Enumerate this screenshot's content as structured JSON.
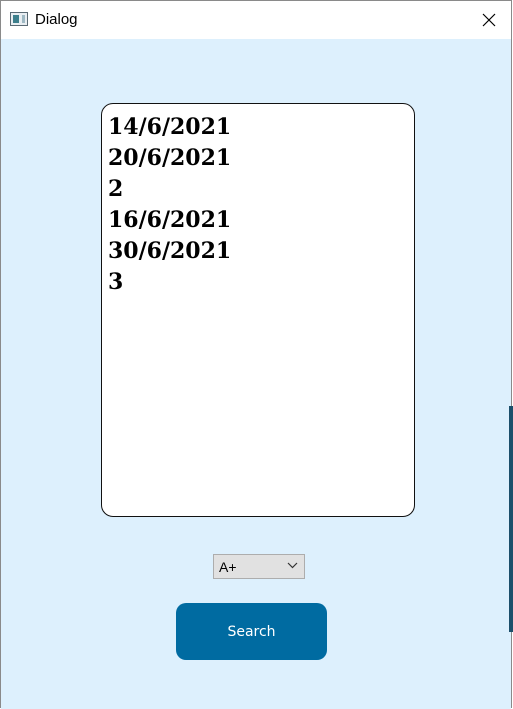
{
  "window": {
    "title": "Dialog",
    "icon": "window-app-icon",
    "close_icon": "close-icon"
  },
  "results": {
    "lines": [
      "14/6/2021",
      "20/6/2021",
      "2",
      "16/6/2021",
      "30/6/2021",
      "3"
    ]
  },
  "font_size_select": {
    "selected": "A+",
    "icon": "chevron-down-icon"
  },
  "search_button": {
    "label": "Search"
  },
  "colors": {
    "background": "#ddf0fd",
    "button": "#006ba1",
    "button_text": "#ffffff",
    "select_bg": "#e1e1e1"
  }
}
